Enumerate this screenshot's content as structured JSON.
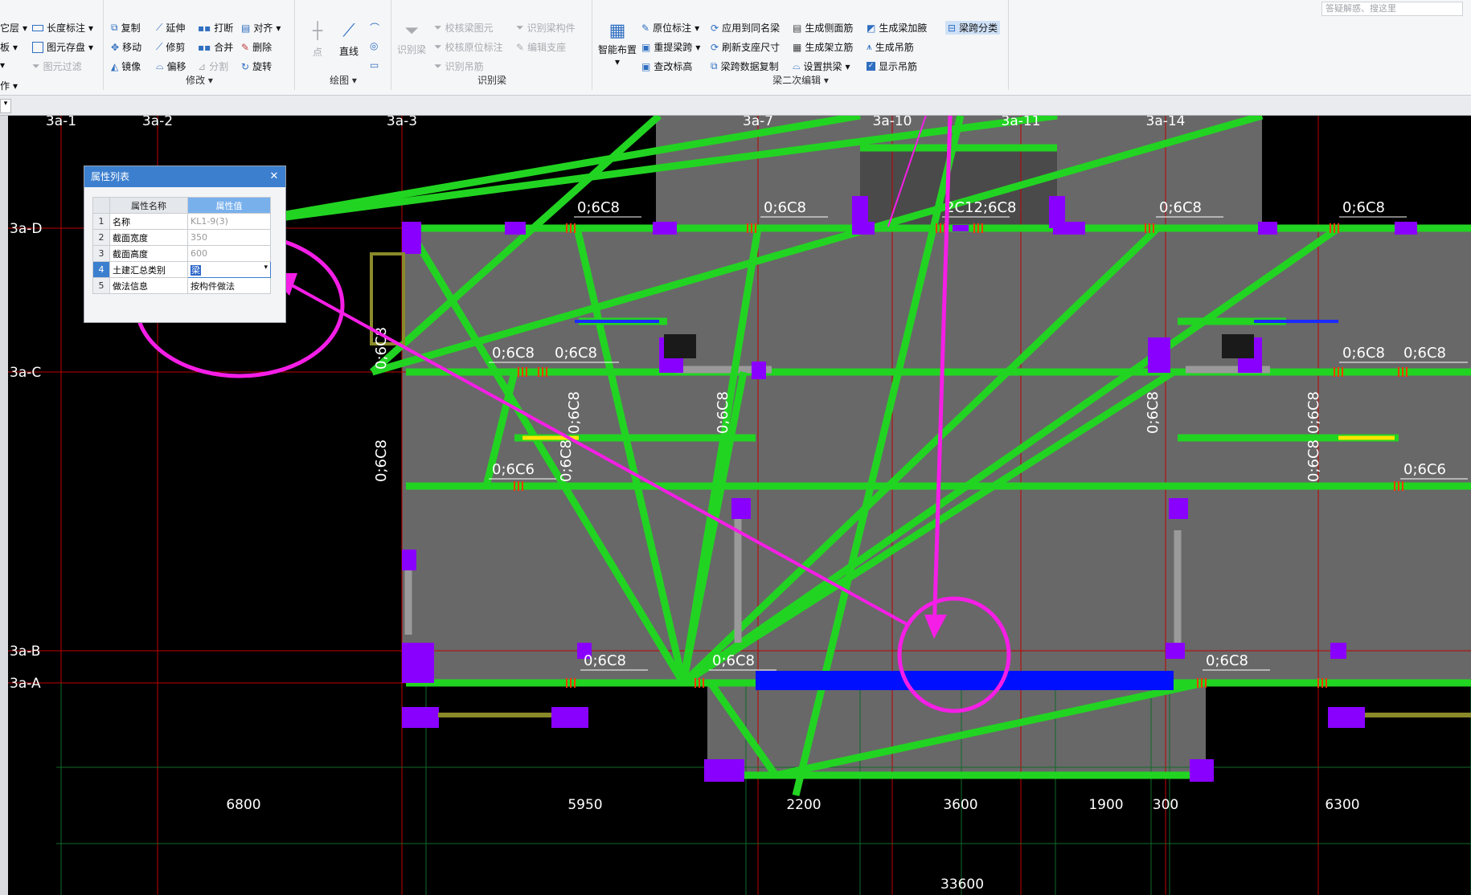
{
  "search": {
    "placeholder": "答疑解惑、搜这里"
  },
  "ribbon": {
    "col0": [
      "它层",
      "板",
      "作"
    ],
    "col1": [
      "长度标注",
      "图元存盘",
      "图元过滤"
    ],
    "modify": {
      "items": [
        "复制",
        "延伸",
        "打断",
        "对齐",
        "移动",
        "修剪",
        "合并",
        "删除",
        "镜像",
        "偏移",
        "分割",
        "旋转"
      ],
      "label": "修改"
    },
    "draw": {
      "point": "点",
      "line": "直线",
      "label": "绘图"
    },
    "identify": {
      "main": "识别梁",
      "items": [
        "校核梁图元",
        "识别梁构件",
        "校核原位标注",
        "编辑支座",
        "识别吊筋"
      ],
      "label": "识别梁"
    },
    "smart": {
      "label": "智能布置"
    },
    "beam2": {
      "items": [
        "原位标注",
        "应用到同名梁",
        "生成侧面筋",
        "生成梁加腋",
        "梁跨分类",
        "重提梁跨",
        "刷新支座尺寸",
        "生成架立筋",
        "生成吊筋",
        "查改标高",
        "梁跨数据复制",
        "设置拱梁",
        "显示吊筋"
      ],
      "label": "梁二次编辑"
    }
  },
  "property_panel": {
    "title": "属性列表",
    "headers": [
      "属性名称",
      "属性值"
    ],
    "rows": [
      {
        "n": "1",
        "name": "名称",
        "value": "KL1-9(3)"
      },
      {
        "n": "2",
        "name": "截面宽度",
        "value": "350"
      },
      {
        "n": "3",
        "name": "截面高度",
        "value": "600"
      },
      {
        "n": "4",
        "name": "土建汇总类别",
        "value": "梁"
      },
      {
        "n": "5",
        "name": "做法信息",
        "value": "按构件做法"
      }
    ]
  },
  "axes_top": [
    "3a-1",
    "3a-2",
    "3a-3",
    "3a-7",
    "3a-10",
    "3a-11",
    "3a-14"
  ],
  "axes_left": [
    "3a-D",
    "3a-C",
    "3a-B",
    "3a-A"
  ],
  "dimensions": [
    "6800",
    "5950",
    "2200",
    "3600",
    "1900",
    "300",
    "6300"
  ],
  "total_dimension": "33600",
  "rebar_labels": [
    "0;6C8",
    "0;6C8",
    "2C12;6C8",
    "0;6C8",
    "0;6C8",
    "0;6C8",
    "0;6C8",
    "0;6C8",
    "0;6C8",
    "0;6C6",
    "0;6C6",
    "0;6C8",
    "0;6C8",
    "0;6C8",
    "0;6C8",
    "0;6C8",
    "0;6C8",
    "0;6C8",
    "0;6C8",
    "0;6C8",
    "0;6C8",
    "0;6C8"
  ],
  "colors": {
    "beam": "#22d422",
    "column": "#8a00ff",
    "selected": "#0010ff",
    "annotation": "#f51ee6",
    "grid": "#c00000",
    "slab": "#686868"
  }
}
